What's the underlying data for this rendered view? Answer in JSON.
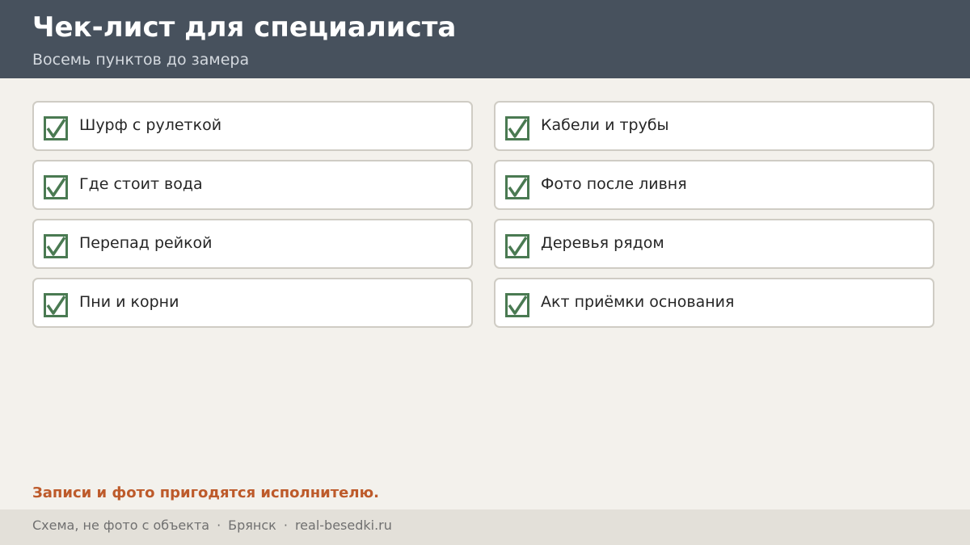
{
  "header": {
    "title": "Чек-лист для специалиста",
    "subtitle": "Восемь пунктов до замера"
  },
  "checklist": {
    "items": [
      {
        "label": "Шурф с рулеткой",
        "checked": true
      },
      {
        "label": "Кабели и трубы",
        "checked": true
      },
      {
        "label": "Где стоит вода",
        "checked": true
      },
      {
        "label": "Фото после ливня",
        "checked": true
      },
      {
        "label": "Перепад рейкой",
        "checked": true
      },
      {
        "label": "Деревья рядом",
        "checked": true
      },
      {
        "label": "Пни и корни",
        "checked": true
      },
      {
        "label": "Акт приёмки основания",
        "checked": true
      }
    ]
  },
  "note": "Записи и фото пригодятся исполнителю.",
  "footer": {
    "parts": [
      "Схема, не фото с объекта",
      "Брянск",
      "real-besedki.ru"
    ],
    "separator": "·"
  },
  "colors": {
    "header_bg": "#47515d",
    "check": "#4a7a52",
    "note": "#bd5a2a",
    "page_bg": "#f3f1ec",
    "footer_bg": "#e3e0d9"
  }
}
